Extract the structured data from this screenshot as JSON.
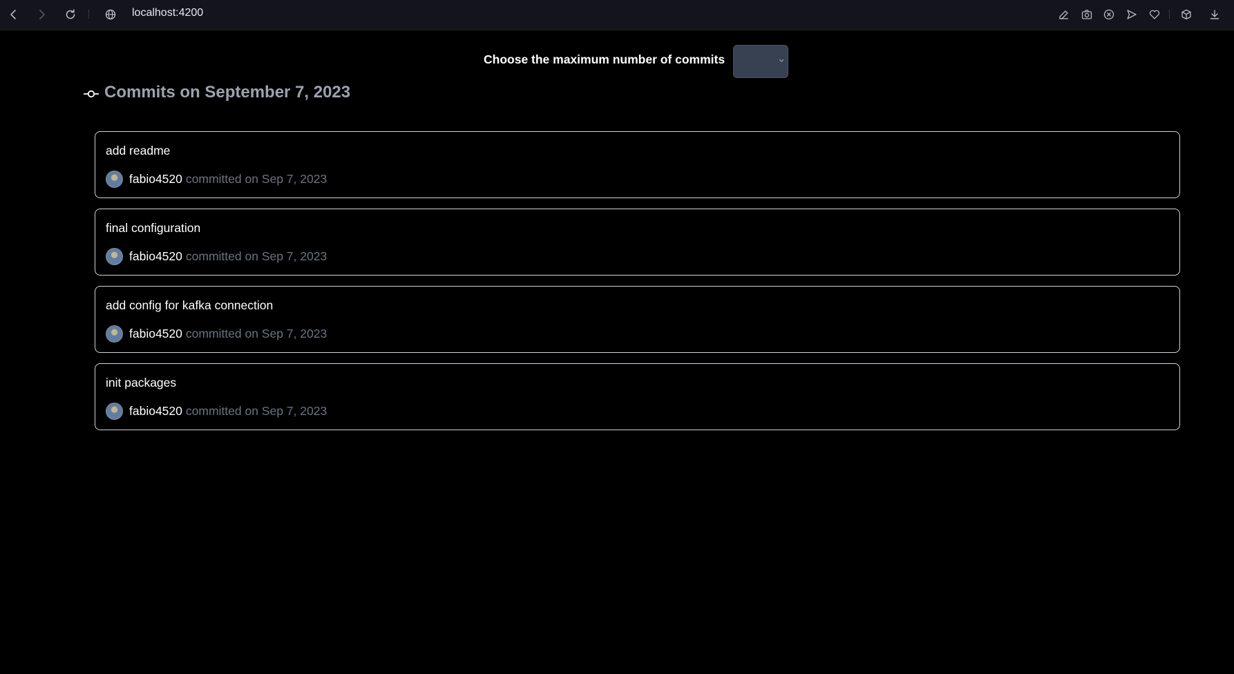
{
  "browser": {
    "url": "localhost:4200"
  },
  "controls": {
    "max_label": "Choose the maximum number of commits",
    "max_value": ""
  },
  "heading": {
    "date_title": "Commits on September 7, 2023"
  },
  "commits": [
    {
      "message": "add readme",
      "author": "fabio4520",
      "meta": "committed on Sep 7, 2023"
    },
    {
      "message": "final configuration",
      "author": "fabio4520",
      "meta": "committed on Sep 7, 2023"
    },
    {
      "message": "add config for kafka connection",
      "author": "fabio4520",
      "meta": "committed on Sep 7, 2023"
    },
    {
      "message": "init packages",
      "author": "fabio4520",
      "meta": "committed on Sep 7, 2023"
    }
  ],
  "icons": {
    "back": "back-arrow-icon",
    "forward": "forward-arrow-icon",
    "reload": "reload-icon",
    "site": "globe-icon",
    "toolbar": [
      "edit-icon",
      "camera-icon",
      "close-circle-icon",
      "send-icon",
      "heart-icon",
      "cube-icon",
      "download-icon"
    ]
  },
  "colors": {
    "background": "#000000",
    "chrome": "#14141c",
    "muted_text": "#6b7280",
    "heading_text": "#9ca3af",
    "select_bg": "#374151"
  }
}
